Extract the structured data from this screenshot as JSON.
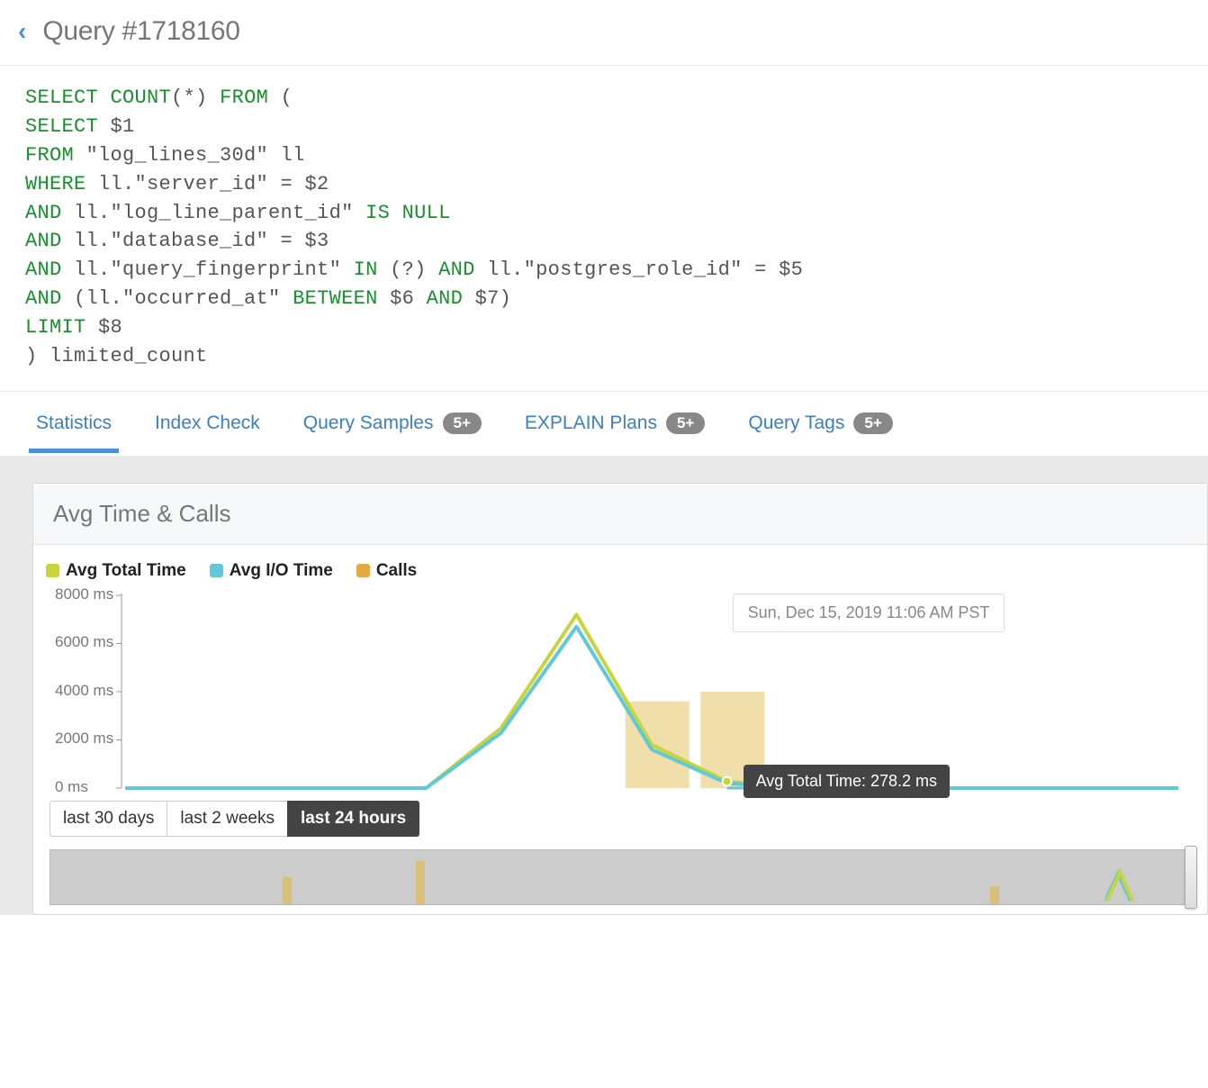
{
  "header": {
    "title": "Query #1718160"
  },
  "query": {
    "tokens": [
      [
        {
          "t": "SELECT",
          "c": "kw"
        },
        {
          "t": " ",
          "c": "txt"
        },
        {
          "t": "COUNT",
          "c": "kw"
        },
        {
          "t": "(*) ",
          "c": "txt"
        },
        {
          "t": "FROM",
          "c": "kw"
        },
        {
          "t": " (",
          "c": "txt"
        }
      ],
      [
        {
          "t": "SELECT",
          "c": "kw"
        },
        {
          "t": " $1",
          "c": "txt"
        }
      ],
      [
        {
          "t": "FROM",
          "c": "kw"
        },
        {
          "t": " \"log_lines_30d\" ll",
          "c": "txt"
        }
      ],
      [
        {
          "t": "WHERE",
          "c": "kw"
        },
        {
          "t": " ll.\"server_id\" = $2",
          "c": "txt"
        }
      ],
      [
        {
          "t": "AND",
          "c": "kw"
        },
        {
          "t": " ll.\"log_line_parent_id\" ",
          "c": "txt"
        },
        {
          "t": "IS NULL",
          "c": "kw"
        }
      ],
      [
        {
          "t": "AND",
          "c": "kw"
        },
        {
          "t": " ll.\"database_id\" = $3",
          "c": "txt"
        }
      ],
      [
        {
          "t": "AND",
          "c": "kw"
        },
        {
          "t": " ll.\"query_fingerprint\" ",
          "c": "txt"
        },
        {
          "t": "IN",
          "c": "kw"
        },
        {
          "t": " (?) ",
          "c": "txt"
        },
        {
          "t": "AND",
          "c": "kw"
        },
        {
          "t": " ll.\"postgres_role_id\" = $5",
          "c": "txt"
        }
      ],
      [
        {
          "t": "AND",
          "c": "kw"
        },
        {
          "t": " (ll.\"occurred_at\" ",
          "c": "txt"
        },
        {
          "t": "BETWEEN",
          "c": "kw"
        },
        {
          "t": " $6 ",
          "c": "txt"
        },
        {
          "t": "AND",
          "c": "kw"
        },
        {
          "t": " $7)",
          "c": "txt"
        }
      ],
      [
        {
          "t": "LIMIT",
          "c": "kw"
        },
        {
          "t": " $8",
          "c": "txt"
        }
      ],
      [
        {
          "t": ") limited_count",
          "c": "txt"
        }
      ]
    ]
  },
  "tabs": [
    {
      "label": "Statistics",
      "badge": null,
      "active": true
    },
    {
      "label": "Index Check",
      "badge": null,
      "active": false
    },
    {
      "label": "Query Samples",
      "badge": "5+",
      "active": false
    },
    {
      "label": "EXPLAIN Plans",
      "badge": "5+",
      "active": false
    },
    {
      "label": "Query Tags",
      "badge": "5+",
      "active": false
    }
  ],
  "card": {
    "title": "Avg Time & Calls"
  },
  "legend": [
    {
      "label": "Avg Total Time",
      "color": "#c9d43a"
    },
    {
      "label": "Avg I/O Time",
      "color": "#5fc9d8"
    },
    {
      "label": "Calls",
      "color": "#e2a93f"
    }
  ],
  "chart_data": {
    "type": "line",
    "ylabel": "ms",
    "ylim": [
      0,
      8000
    ],
    "yticks": [
      "0 ms",
      "2000 ms",
      "4000 ms",
      "6000 ms",
      "8000 ms"
    ],
    "x_points": 15,
    "series": [
      {
        "name": "Avg Total Time",
        "color": "#c9d43a",
        "values": [
          0,
          0,
          0,
          0,
          0,
          2500,
          7200,
          1800,
          278,
          0,
          0,
          0,
          0,
          0,
          0
        ]
      },
      {
        "name": "Avg I/O Time",
        "color": "#5fc9d8",
        "values": [
          0,
          0,
          0,
          0,
          0,
          2300,
          6700,
          1600,
          200,
          0,
          0,
          0,
          0,
          0,
          0
        ]
      }
    ],
    "bars": {
      "name": "Calls",
      "color": "#f0deab",
      "indices": [
        7,
        8
      ],
      "heights": [
        3600,
        4000
      ]
    },
    "tooltip_time": "Sun, Dec 15, 2019 11:06 AM PST",
    "tooltip_value": "Avg Total Time: 278.2 ms"
  },
  "time_range": {
    "options": [
      "last 30 days",
      "last 2 weeks",
      "last 24 hours"
    ],
    "active": 2
  },
  "colors": {
    "accent": "#4a90d9"
  }
}
